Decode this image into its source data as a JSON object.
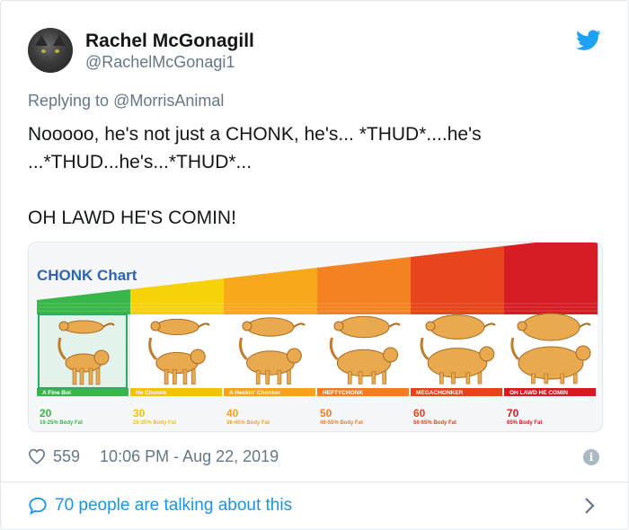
{
  "tweet": {
    "display_name": "Rachel McGonagill",
    "handle": "@RachelMcGonagi1",
    "reply_prefix": "Replying to",
    "reply_mention": "@MorrisAnimal",
    "text_lines": [
      "Nooooo, he's not just a CHONK, he's... *THUD*....he's",
      "...*THUD...he's...*THUD*...",
      "",
      "OH LAWD HE'S COMIN!"
    ],
    "likes": "559",
    "timestamp": "10:06 PM - Aug 22, 2019",
    "conversation": "70 people are talking about this",
    "icons": {
      "brand": "twitter-bird-icon",
      "like": "heart-icon",
      "info": "info-icon",
      "reply": "speech-bubble-icon",
      "open": "chevron-right-icon"
    },
    "colors": {
      "link": "#1b95e0",
      "muted": "#657786",
      "text": "#14171a"
    }
  },
  "chart": {
    "title": "CHONK Chart",
    "categories": [
      {
        "label": "A Fine Boi",
        "value": "20",
        "fat": "16-25% Body Fat",
        "band": "#3ab54a",
        "top": "#3ab54a"
      },
      {
        "label": "He Chonnk",
        "value": "30",
        "fat": "26-35% Body Fat",
        "band": "#f2c300",
        "top": "#f5d20a"
      },
      {
        "label": "A Heckin' Chonker",
        "value": "40",
        "fat": "36-45% Body Fat",
        "band": "#f5a31a",
        "top": "#f7a81b"
      },
      {
        "label": "HEFTYCHONK",
        "value": "50",
        "fat": "46-55% Body Fat",
        "band": "#f47b20",
        "top": "#f58220"
      },
      {
        "label": "MEGACHONKER",
        "value": "60",
        "fat": "56-65% Body Fat",
        "band": "#e8411c",
        "top": "#e8441d"
      },
      {
        "label": "OH LAWD HE COMIN",
        "value": "70",
        "fat": "65% Body Fat",
        "band": "#d71920",
        "top": "#d71d24"
      }
    ]
  }
}
